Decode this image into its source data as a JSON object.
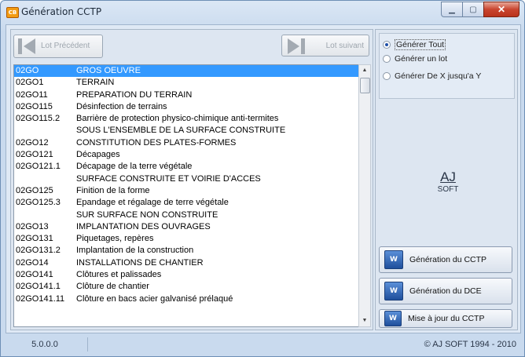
{
  "window": {
    "title": "Génération CCTP",
    "icon_text": "CB"
  },
  "nav": {
    "prev_label": "Lot Précédent",
    "next_label": "Lot suivant"
  },
  "lots": [
    {
      "code": "02GO",
      "label": "GROS OEUVRE",
      "selected": true
    },
    {
      "code": "02GO1",
      "label": "TERRAIN"
    },
    {
      "code": "02GO11",
      "label": "PREPARATION DU TERRAIN"
    },
    {
      "code": "02GO115",
      "label": "Désinfection de terrains"
    },
    {
      "code": "02GO115.2",
      "label": "Barrière de protection physico-chimique anti-termites"
    },
    {
      "code": "",
      "label": "SOUS L'ENSEMBLE DE LA SURFACE CONSTRUITE"
    },
    {
      "code": "02GO12",
      "label": "CONSTITUTION DES PLATES-FORMES"
    },
    {
      "code": "02GO121",
      "label": "Décapages"
    },
    {
      "code": "02GO121.1",
      "label": "Décapage de la terre végétale"
    },
    {
      "code": "",
      "label": "SURFACE CONSTRUITE ET VOIRIE D'ACCES"
    },
    {
      "code": "02GO125",
      "label": "Finition de la forme"
    },
    {
      "code": "02GO125.3",
      "label": "Epandage et régalage de terre végétale"
    },
    {
      "code": "",
      "label": "SUR SURFACE NON CONSTRUITE"
    },
    {
      "code": "02GO13",
      "label": "IMPLANTATION DES OUVRAGES"
    },
    {
      "code": "02GO131",
      "label": "Piquetages, repères"
    },
    {
      "code": "02GO131.2",
      "label": "Implantation de la construction"
    },
    {
      "code": "02GO14",
      "label": "INSTALLATIONS DE CHANTIER"
    },
    {
      "code": "02GO141",
      "label": "Clôtures et palissades"
    },
    {
      "code": "02GO141.1",
      "label": "Clôture de chantier"
    },
    {
      "code": "02GO141.11",
      "label": "Clôture en bacs acier galvanisé prélaqué"
    }
  ],
  "options": {
    "all": "Générer Tout",
    "one": "Générer un lot",
    "range": "Générer De X jusqu'a Y",
    "selected": "all"
  },
  "logo": {
    "aj": "AJ",
    "soft": "SOFT"
  },
  "actions": {
    "cctp": "Génération du CCTP",
    "dce": "Génération du DCE",
    "update": "Mise à jour du CCTP"
  },
  "status": {
    "version": "5.0.0.0",
    "copyright": "© AJ SOFT 1994 - 2010"
  }
}
